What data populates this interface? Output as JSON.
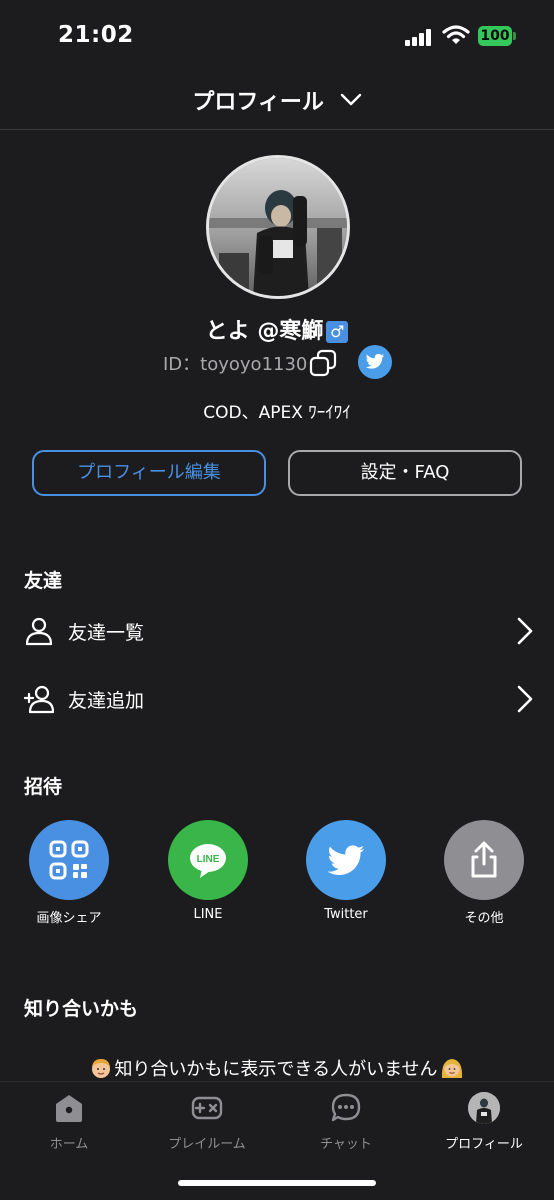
{
  "status_bar": {
    "time": "21:02",
    "battery": "100"
  },
  "header": {
    "title": "プロフィール"
  },
  "profile": {
    "name": "とよ @寒鰤",
    "gender_symbol": "♂",
    "id_text": "ID：toyoyo1130",
    "bio": "COD、APEX ﾜｰｲﾜｲ",
    "edit_label": "プロフィール編集",
    "settings_label": "設定・FAQ"
  },
  "friends": {
    "title": "友達",
    "items": [
      {
        "label": "友達一覧",
        "icon": "person-icon"
      },
      {
        "label": "友達追加",
        "icon": "person-add-icon"
      }
    ]
  },
  "invite": {
    "title": "招待",
    "items": [
      {
        "label": "画像シェア",
        "icon": "qr-code-icon",
        "color": "#4a90e2"
      },
      {
        "label": "LINE",
        "icon": "line-icon",
        "color": "#3ab54a"
      },
      {
        "label": "Twitter",
        "icon": "twitter-icon",
        "color": "#4a9de8"
      },
      {
        "label": "その他",
        "icon": "share-icon",
        "color": "#8e8e93"
      }
    ]
  },
  "suggest": {
    "title": "知り合いかも",
    "empty_message": "知り合いかもに表示できる人がいません"
  },
  "tabs": [
    {
      "label": "ホーム",
      "icon": "home-icon"
    },
    {
      "label": "プレイルーム",
      "icon": "gamepad-icon"
    },
    {
      "label": "チャット",
      "icon": "chat-icon"
    },
    {
      "label": "プロフィール",
      "icon": "avatar",
      "active": true
    }
  ],
  "colors": {
    "background": "#1c1c1e",
    "accent": "#4a90e2",
    "muted": "#a8a8ad"
  }
}
